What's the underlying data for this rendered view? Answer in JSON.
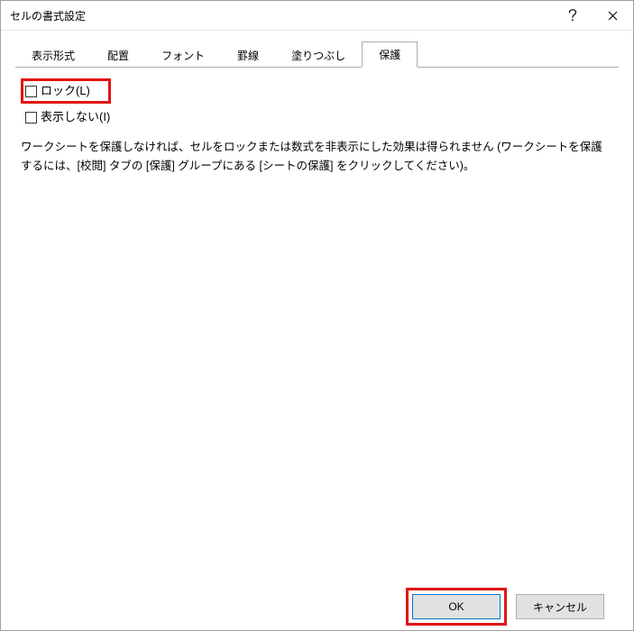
{
  "window": {
    "title": "セルの書式設定"
  },
  "tabs": {
    "t0": "表示形式",
    "t1": "配置",
    "t2": "フォント",
    "t3": "罫線",
    "t4": "塗りつぶし",
    "t5": "保護"
  },
  "protection": {
    "lock_label": "ロック(L)",
    "hide_label": "表示しない(I)",
    "description": "ワークシートを保護しなければ、セルをロックまたは数式を非表示にした効果は得られません (ワークシートを保護するには、[校閲] タブの [保護] グループにある [シートの保護] をクリックしてください)。"
  },
  "buttons": {
    "ok": "OK",
    "cancel": "キャンセル"
  }
}
